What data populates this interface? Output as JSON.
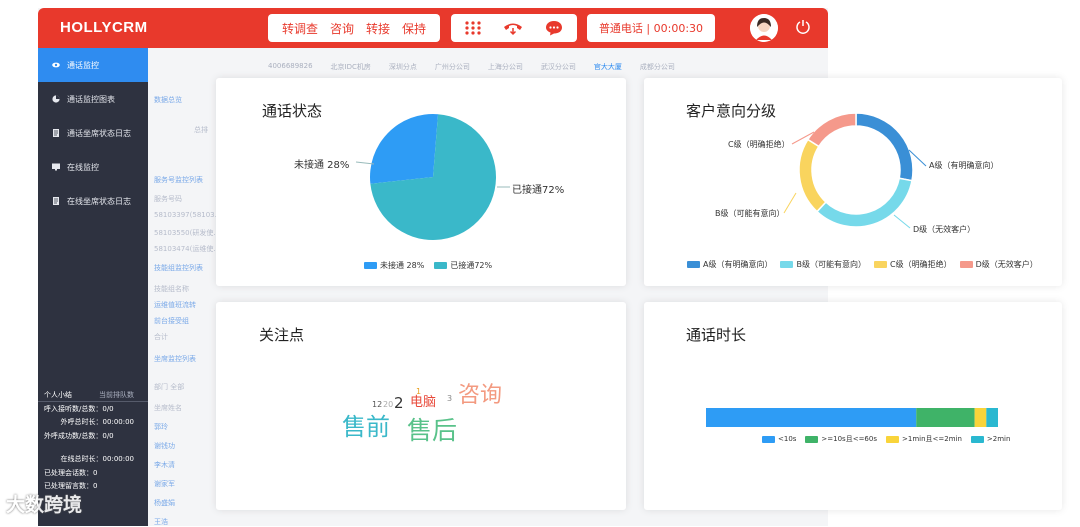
{
  "header": {
    "brand": "HOLLYCRM",
    "menu": [
      "转调查",
      "咨询",
      "转接",
      "保持"
    ],
    "call_label": "普通电话 | 00:00:30",
    "icons": [
      "dialpad-icon",
      "hangup-icon",
      "chat-icon",
      "avatar-icon",
      "power-icon"
    ]
  },
  "sidebar": {
    "items": [
      {
        "label": "通话监控",
        "icon": "eye-icon",
        "active": true
      },
      {
        "label": "通话监控图表",
        "icon": "pie-icon",
        "active": false
      },
      {
        "label": "通话坐席状态日志",
        "icon": "doc-icon",
        "active": false
      },
      {
        "label": "在线监控",
        "icon": "monitor-icon",
        "active": false
      },
      {
        "label": "在线坐席状态日志",
        "icon": "doc-icon",
        "active": false
      }
    ]
  },
  "personal": {
    "tab_active": "个人小结",
    "tab_other": "当前排队数",
    "rows": [
      {
        "label": "呼入接听数/总数：",
        "value": "0/0"
      },
      {
        "label": "外呼总时长：",
        "value": "00:00:00"
      },
      {
        "label": "外呼成功数/总数：",
        "value": "0/0"
      },
      {
        "label": "在线总时长：",
        "value": "00:00:00"
      },
      {
        "label": "已处理会话数：",
        "value": "0"
      },
      {
        "label": "已处理留言数：",
        "value": "0"
      }
    ],
    "watermark": "大数跨境"
  },
  "background": {
    "cities": [
      "4006689826",
      "北京IDC机房",
      "深圳分点",
      "广州分公司",
      "上海分公司",
      "武汉分公司",
      "官大大厦",
      "成都分公司"
    ],
    "lines": [
      {
        "text": "数据总览",
        "blue": true
      },
      {
        "text": "总排",
        "blue": false
      },
      {
        "text": "服务号监控列表",
        "blue": true
      },
      {
        "text": "服务号码",
        "blue": false
      },
      {
        "text": "58103397(58103…",
        "blue": false
      },
      {
        "text": "58103550(研发使…",
        "blue": false
      },
      {
        "text": "58103474(运维使…",
        "blue": false
      },
      {
        "text": "技能组监控列表",
        "blue": true
      },
      {
        "text": "技能组名称",
        "blue": false
      },
      {
        "text": "运维值班流转",
        "blue": true
      },
      {
        "text": "前台接受组",
        "blue": true
      },
      {
        "text": "合计",
        "blue": false
      },
      {
        "text": "坐席监控列表",
        "blue": true
      },
      {
        "text": "部门    全部",
        "blue": false
      },
      {
        "text": "坐席姓名",
        "blue": false
      }
    ],
    "names": [
      "郭玲",
      "谢钱功",
      "李木清",
      "谢家军",
      "杨盛娟",
      "王浩"
    ]
  },
  "cards": {
    "call_status": {
      "title": "通话状态"
    },
    "intent": {
      "title": "客户意向分级"
    },
    "focus": {
      "title": "关注点"
    },
    "duration": {
      "title": "通话时长"
    }
  },
  "chart_data": [
    {
      "type": "pie",
      "title": "通话状态",
      "labels": [
        "未接通",
        "已接通"
      ],
      "values": [
        28,
        72
      ],
      "slice_labels": [
        "未接通 28%",
        "已接通72%"
      ],
      "legend": [
        "未接通 28%",
        "已接通72%"
      ],
      "colors": [
        "#2e9cf5",
        "#3ab8c9"
      ],
      "legend_position": "bottom"
    },
    {
      "type": "pie",
      "title": "客户意向分级",
      "donut": true,
      "labels": [
        "A级（有明确意向）",
        "B级（可能有意向）",
        "C级（明确拒绝）",
        "D级（无效客户）"
      ],
      "values": [
        28,
        34,
        22,
        16
      ],
      "colors": [
        "#3a8fd6",
        "#76d9ea",
        "#f9d45e",
        "#f5998b"
      ],
      "slice_labels": [
        "A级（有明确意向）",
        "D级（无效客户）",
        "B级（可能有意向）",
        "C级（明确拒绝）"
      ],
      "legend": [
        "A级（有明确意向）",
        "B级（可能有意向）",
        "C级（明确拒绝）",
        "D级（无效客户）"
      ],
      "legend_position": "bottom"
    },
    {
      "type": "wordcloud",
      "title": "关注点",
      "words": [
        {
          "text": "售前",
          "weight": 10,
          "color": "#3ab8c9"
        },
        {
          "text": "售后",
          "weight": 10,
          "color": "#59c28a"
        },
        {
          "text": "咨询",
          "weight": 8,
          "color": "#f39a80"
        },
        {
          "text": "电脑",
          "weight": 5,
          "color": "#e8493a"
        },
        {
          "text": "2",
          "weight": 5,
          "color": "#333333"
        },
        {
          "text": "3",
          "weight": 2,
          "color": "#888888"
        },
        {
          "text": "1",
          "weight": 2,
          "color": "#e8a020"
        },
        {
          "text": "12",
          "weight": 2,
          "color": "#555555"
        },
        {
          "text": "20",
          "weight": 2,
          "color": "#aaaaaa"
        }
      ]
    },
    {
      "type": "bar",
      "stacked": true,
      "horizontal": true,
      "title": "通话时长",
      "series": [
        {
          "name": "<10s",
          "value": 72,
          "color": "#2e9cf5"
        },
        {
          "name": ">=10s且<=60s",
          "value": 20,
          "color": "#3fb368"
        },
        {
          "name": ">1min且<=2min",
          "value": 4,
          "color": "#f9d43a"
        },
        {
          "name": ">2min",
          "value": 4,
          "color": "#2ab8d0"
        }
      ],
      "legend_position": "bottom"
    }
  ]
}
